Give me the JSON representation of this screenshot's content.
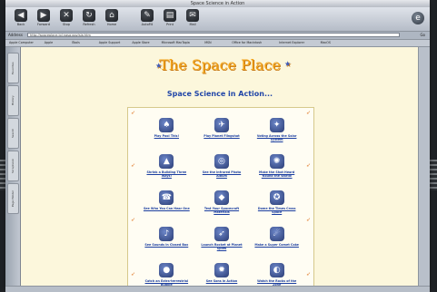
{
  "window": {
    "title": "Space Science in Action"
  },
  "toolbar": {
    "buttons": [
      {
        "label": "Back",
        "icon": "back-arrow-icon",
        "glyph": "◀"
      },
      {
        "label": "Forward",
        "icon": "forward-arrow-icon",
        "glyph": "▶"
      },
      {
        "label": "Stop",
        "icon": "stop-icon",
        "glyph": "✕"
      },
      {
        "label": "Refresh",
        "icon": "refresh-icon",
        "glyph": "↻"
      },
      {
        "label": "Home",
        "icon": "home-icon",
        "glyph": "⌂"
      },
      {
        "label": "AutoFill",
        "icon": "autofill-icon",
        "glyph": "✎"
      },
      {
        "label": "Print",
        "icon": "print-icon",
        "glyph": "▤"
      },
      {
        "label": "Mail",
        "icon": "mail-icon",
        "glyph": "✉"
      }
    ]
  },
  "address": {
    "label": "Address",
    "url": "http://spaceplace.jpl.nasa.gov/sia.htm",
    "go_label": "Go"
  },
  "favorites": [
    "Apple Computer",
    "Apple",
    "iTools",
    "Apple Support",
    "Apple Store",
    "Microsoft MacTopia",
    "MSN",
    "Office for Macintosh",
    "Internet Explorer",
    "MacOS"
  ],
  "sidebar": {
    "tabs": [
      "Favorites",
      "History",
      "Search",
      "Scrapbook",
      "Page Holder"
    ]
  },
  "page": {
    "site_title": "The Space Place",
    "heading": "Space Science in Action...",
    "cells": [
      {
        "caption": "Play Pool This!",
        "glyph": "♠"
      },
      {
        "caption": "Play Planet Flingshot",
        "glyph": "✈"
      },
      {
        "caption": "Voting Across the Solar System",
        "glyph": "✦"
      },
      {
        "caption": "Shrink a Building Three Ways!",
        "glyph": "▲"
      },
      {
        "caption": "See the Infrared Photo Album",
        "glyph": "◎"
      },
      {
        "caption": "Make the Shot Heard 'Round the World!",
        "glyph": "✺"
      },
      {
        "caption": "See Who You Can Hear One",
        "glyph": "☎"
      },
      {
        "caption": "Test Your Spacecraft Materials",
        "glyph": "◆"
      },
      {
        "caption": "Dome the Times Cross Space",
        "glyph": "✪"
      },
      {
        "caption": "See Sounds in Closed Box",
        "glyph": "♪"
      },
      {
        "caption": "Launch Rocket at Planet Spots",
        "glyph": "➶"
      },
      {
        "caption": "Make a Super Comet Cake",
        "glyph": "☄"
      },
      {
        "caption": "Catch an Extra-terrestrial Bubble",
        "glyph": "●"
      },
      {
        "caption": "See Sons in Action",
        "glyph": "✹"
      },
      {
        "caption": "Watch the Rocks of the Zone",
        "glyph": "◐"
      }
    ]
  }
}
